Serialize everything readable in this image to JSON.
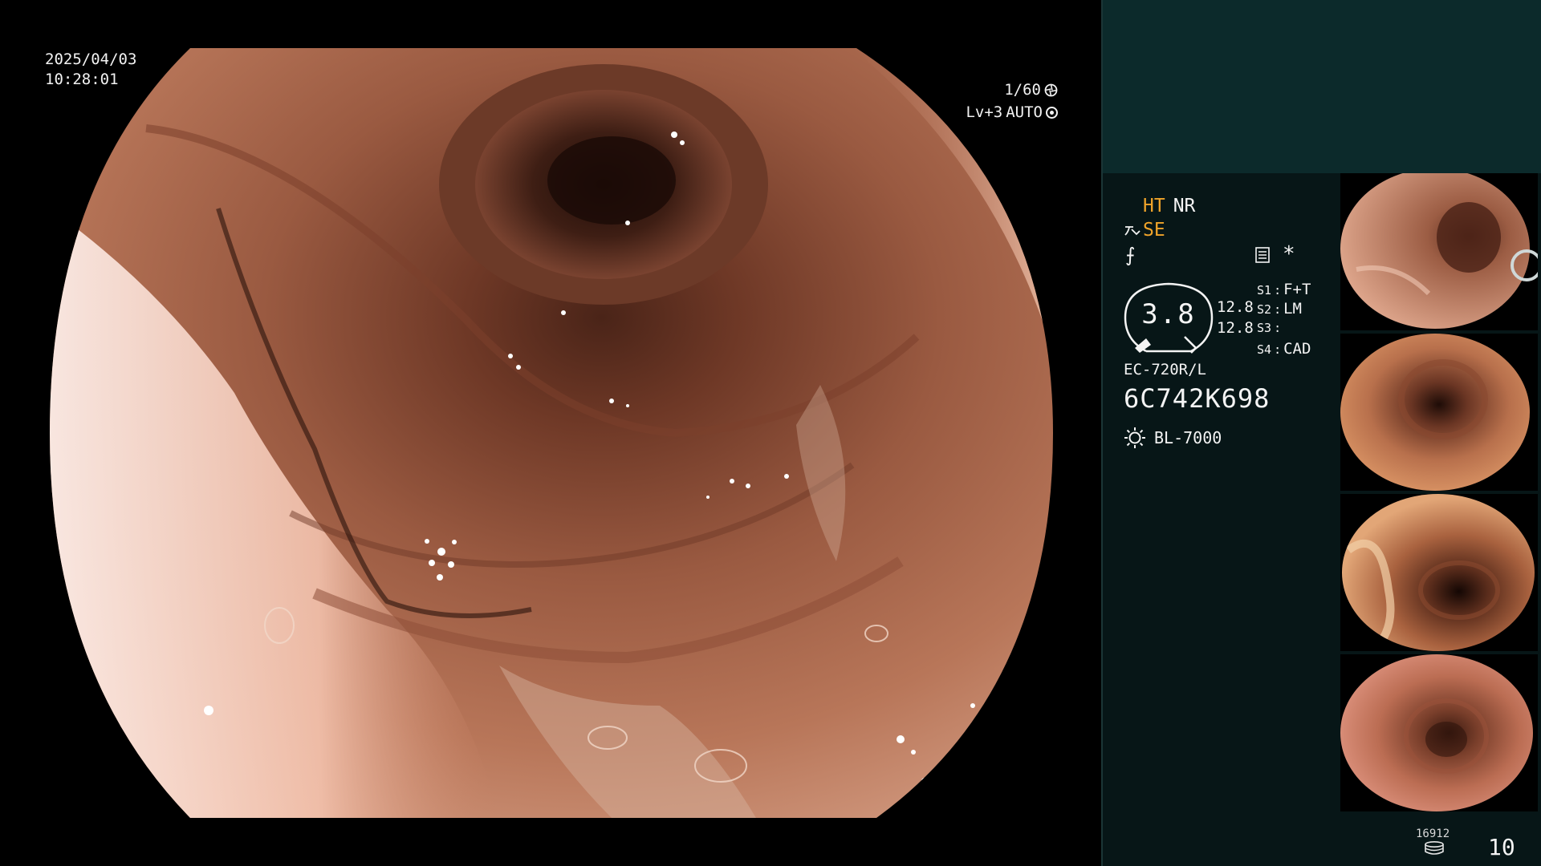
{
  "osd": {
    "date": "2025/04/03",
    "time": "10:28:01",
    "shutter": "1/60",
    "level": "Lv+3",
    "exposure_mode": "AUTO"
  },
  "panel": {
    "ht": "HT",
    "nr": "NR",
    "se": "SE",
    "ring_value": "3.8",
    "ring_val_a": "12.8",
    "ring_val_b": "12.8",
    "switches": [
      {
        "key": "S1",
        "value": "F+T"
      },
      {
        "key": "S2",
        "value": "LM"
      },
      {
        "key": "S3",
        "value": ""
      },
      {
        "key": "S4",
        "value": "CAD"
      }
    ],
    "scope_model": "EC-720R/L",
    "serial": "6C742K698",
    "light_source": "BL-7000",
    "star": "*",
    "f_glyph": "⨍"
  },
  "footer": {
    "storage_count": "16912",
    "image_count": "10"
  },
  "icons": {
    "shutter": "aperture-icon",
    "auto": "ring-icon",
    "light": "sun-icon",
    "memo": "memo-icon",
    "storage": "database-icon"
  },
  "colors": {
    "accent_orange": "#f0a42a",
    "panel_top": "#0c2a2b",
    "panel": "#071617"
  }
}
